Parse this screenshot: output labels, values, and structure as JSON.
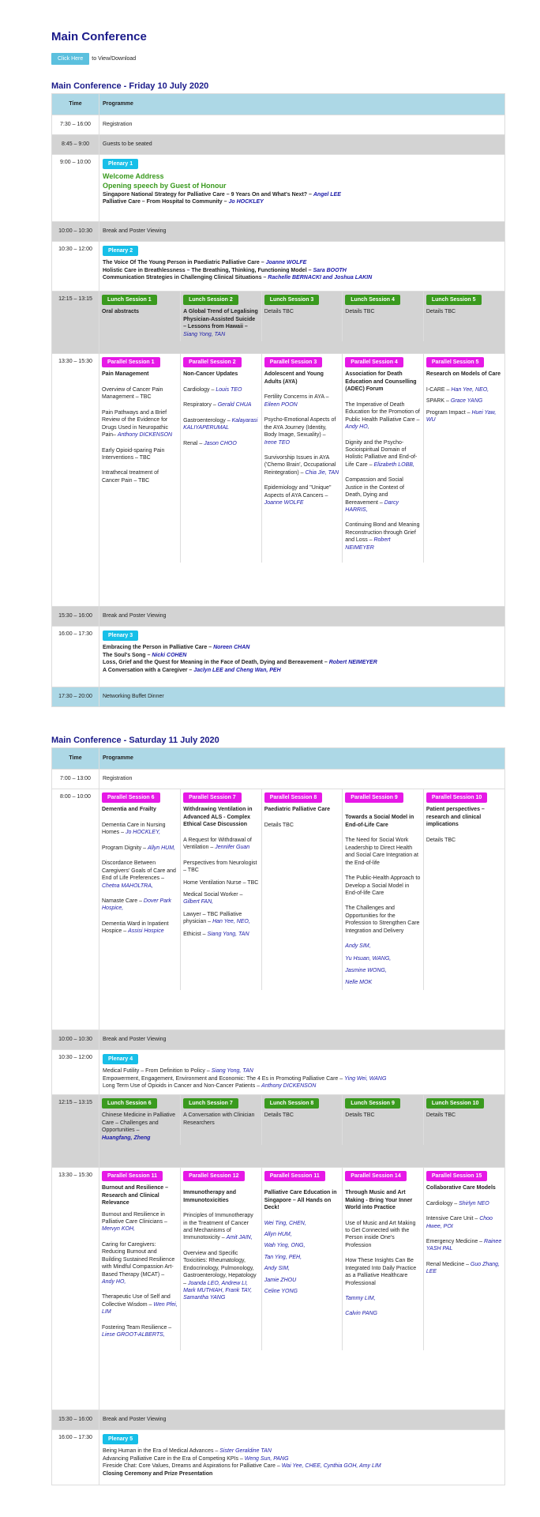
{
  "page_title": "Main Conference",
  "download": {
    "button": "Click Here",
    "text": "to View/Download"
  },
  "day1": {
    "heading": "Main Conference - Friday 10 July 2020"
  },
  "day2": {
    "heading": "Main Conference - Saturday 11 July 2020"
  },
  "table_headers": {
    "time": "Time",
    "programme": "Programme"
  },
  "d1": {
    "r1": {
      "time": "7:30 – 16:00",
      "text": "Registration"
    },
    "r2": {
      "time": "8:45 – 9:00",
      "text": "Guests to be seated"
    },
    "r3": {
      "time": "9:00 – 10:00",
      "badge": "Plenary 1",
      "welcome": "Welcome Address",
      "opening": "Opening speech by Guest of Honour",
      "l1": "Singapore National Strategy for Palliative Care – 9 Years On and What's Next? –",
      "l1s": "Angel LEE",
      "l2": "Palliative Care – From Hospital to Community –",
      "l2s": "Jo HOCKLEY"
    },
    "r4": {
      "time": "10:00 – 10:30",
      "text": "Break and Poster Viewing"
    },
    "r5": {
      "time": "10:30 – 12:00",
      "badge": "Plenary 2",
      "l1": "The Voice Of The Young Person in Paediatric Palliative Care –",
      "l1s": "Joanne WOLFE",
      "l2": "Holistic Care in Breathlessness – The Breathing, Thinking, Functioning Model –",
      "l2s": "Sara BOOTH",
      "l3": "Communication Strategies in Challenging Clinical Situations –",
      "l3s": "Rachelle BERNACKI and Joshua LAKIN"
    },
    "r6": {
      "time": "12:15 – 13:15",
      "c1b": "Lunch Session 1",
      "c1": "Oral abstracts",
      "c2b": "Lunch Session 2",
      "c2": "A Global Trend of Legalising Physician-Assisted Suicide – Lessons from Hawaii –",
      "c2s": "Siang Yong, TAN",
      "c3b": "Lunch Session 3",
      "c3": "Details TBC",
      "c4b": "Lunch Session 4",
      "c4": "Details TBC",
      "c5b": "Lunch Session 5",
      "c5": "Details TBC"
    },
    "r7": {
      "time": "13:30 – 15:30",
      "p1b": "Parallel Session 1",
      "p1t": "Pain Management",
      "p1a": "Overview of Cancer Pain Management – TBC",
      "p1c": "Pain Pathways and a Brief Review of the Evidence for Drugs Used in Neuropathic Pain–",
      "p1cs": "Anthony DICKENSON",
      "p1d": "Early Opioid-sparing Pain Interventions – TBC",
      "p1e": "Intrathecal treatment of Cancer Pain – TBC",
      "p2b": "Parallel Session 2",
      "p2t": "Non-Cancer Updates",
      "p2a": "Cardiology –",
      "p2as": "Louis TEO",
      "p2c": "Respiratory –",
      "p2cs": "Gerald CHUA",
      "p2d": "Gastroenterology –",
      "p2ds": "Kalayarasi KALIYAPERUMAL",
      "p2e": "Renal –",
      "p2es": "Jason CHOO",
      "p3b": "Parallel Session 3",
      "p3t": "Adolescent and Young Adults (AYA)",
      "p3a": "Fertility Concerns in AYA –",
      "p3as": "Eileen POON",
      "p3c": "Psycho-Emotional Aspects of the AYA Journey (Identity, Body Image, Sexuality) –",
      "p3cs": "Irene TEO",
      "p3d": "Survivorship Issues in AYA ('Chemo Brain', Occupational Reintegration) –",
      "p3ds": "Chia Jie, TAN",
      "p3e": "Epidemiology and \"Unique\" Aspects of AYA Cancers –",
      "p3es": "Joanne WOLFE",
      "p4b": "Parallel Session 4",
      "p4t": "Association for Death Education and Counselling (ADEC) Forum",
      "p4a": "The Imperative of Death Education for the Promotion of Public Health Palliative Care –",
      "p4as": "Andy HO,",
      "p4c": "Dignity and the Psycho-Socioispiritual Domain of Holistic Palliative and End-of-Life Care –",
      "p4cs": "Elizabeth LOBB,",
      "p4d": "Compassion and Social Justice in the Context of Death, Dying and Bereavement –",
      "p4ds": "Darcy HARRIS,",
      "p4e": "Continuing Bond and Meaning Reconstruction through Grief and Loss –",
      "p4es": "Robert NEIMEYER",
      "p5b": "Parallel Session 5",
      "p5t": "Research on Models of Care",
      "p5a": "I-CARE –",
      "p5as": "Han Yee, NEO,",
      "p5c": "SPARK –",
      "p5cs": "Grace YANG",
      "p5d": "Program Impact –",
      "p5ds": "Huei Yaw, WU"
    },
    "r8": {
      "time": "15:30 – 16:00",
      "text": "Break and Poster Viewing"
    },
    "r9": {
      "time": "16:00 – 17:30",
      "badge": "Plenary 3",
      "l1": "Embracing the Person in Palliative Care –",
      "l1s": "Noreen CHAN",
      "l2": "The Soul's Song –",
      "l2s": "Nicki COHEN",
      "l3": "Loss, Grief and the Quest for Meaning in the Face of Death, Dying and Bereavement –",
      "l3s": "Robert NEIMEYER",
      "l4": "A Conversation with a Caregiver –",
      "l4s": "Jaclyn LEE and Cheng Wan, PEH"
    },
    "r10": {
      "time": "17:30 – 20:00",
      "text": "Networking Buffet Dinner"
    }
  },
  "d2": {
    "r1": {
      "time": "7:00 – 13:00",
      "text": "Registration"
    },
    "r2": {
      "time": "8:00 – 10:00",
      "p6b": "Parallel Session 6",
      "p6t": "Dementia and Frailty",
      "p6a": "Dementia Care in Nursing Homes –",
      "p6as": "Jo HOCKLEY,",
      "p6c": "Program Dignity –",
      "p6cs": "Allyn HUM,",
      "p6d": "Discordance Between Caregivers' Goals of Care and End of Life Preferences –",
      "p6ds": "Chetna MAHOLTRA,",
      "p6e": "Namaste Care –",
      "p6es": "Dover Park Hospice,",
      "p6f": "Dementia Ward in Inpatient Hospice –",
      "p6fs": "Assisi Hospice",
      "p7b": "Parallel Session 7",
      "p7t": "Withdrawing Ventilation in Advanced ALS - Complex Ethical Case Discussion",
      "p7a": "A Request for Withdrawal of Ventilation –",
      "p7as": "Jennifer Guan",
      "p7c": "Perspectives from Neurologist – TBC",
      "p7d": "Home Ventilation Nurse – TBC",
      "p7e": "Medical Social Worker –",
      "p7es": "Gilbert FAN,",
      "p7f": "Lawyer – TBC Palliative physician –",
      "p7fs": "Han Yee, NEO,",
      "p7g": "Ethicist –",
      "p7gs": "Siang Yong, TAN",
      "p8b": "Parallel Session 8",
      "p8t": "Paediatric Palliative Care",
      "p8a": "Details TBC",
      "p9b": "Parallel Session 9",
      "p9t": "Towards a Social Model in End-of-Life Care",
      "p9a": "The Need for Social Work Leadership to Direct Health and Social Care Integration at the End-of-life",
      "p9c": "The Public-Health Approach to Develop a Social Model in End-of-life Care",
      "p9d": "The Challenges and Opportunities for the Profession to Strengthen Care Integration and Delivery",
      "p9s1": "Andy SIM,",
      "p9s2": "Yu Hsuan, WANG,",
      "p9s3": "Jasmine WONG,",
      "p9s4": "Nelle MOK",
      "p10b": "Parallel Session 10",
      "p10t": "Patient perspectives – research and clinical implications",
      "p10a": "Details TBC"
    },
    "r3": {
      "time": "10:00 – 10:30",
      "text": "Break and Poster Viewing"
    },
    "r4": {
      "time": "10:30 – 12:00",
      "badge": "Plenary 4",
      "l1": "Medical Futility – From Definition to Policy –",
      "l1s": "Siang Yong, TAN",
      "l2": "Empowerment, Engagement, Environment and Economic: The 4 Es in Promoting Palliative Care –",
      "l2s": "Ying Wei, WANG",
      "l3": "Long Term Use of Opioids in Cancer and Non-Cancer Patients –",
      "l3s": "Anthony DICKENSON"
    },
    "r5": {
      "time": "12:15 – 13:15",
      "c1b": "Lunch Session 6",
      "c1": "Chinese Medicine in Palliative Care – Challenges and Opportunities –",
      "c1s": "Huangfang, Zheng",
      "c2b": "Lunch Session 7",
      "c2": "A Conversation with Clinician Researchers",
      "c3b": "Lunch Session 8",
      "c3": "Details TBC",
      "c4b": "Lunch Session 9",
      "c4": "Details TBC",
      "c5b": "Lunch Session 10",
      "c5": "Details TBC"
    },
    "r6": {
      "time": "13:30 – 15:30",
      "q1b": "Parallel Session 11",
      "q1t": "Burnout and Resilience – Research and Clinical Relevance",
      "q1a": "Burnout and Resilience in Palliative Care Clinicians –",
      "q1as": "Mervyn KOH,",
      "q1c": "Caring for Caregivers: Reducing Burnout and Building Sustained Resilience with Mindful Compassion Art-Based Therapy (MCAT) –",
      "q1cs": "Andy HO,",
      "q1d": "Therapeutic Use of Self and Collective Wisdom –",
      "q1ds": "Wen Pfei, LIM",
      "q1e": "Fostering Team Resilience –",
      "q1es": "Liese GROOT-ALBERTS,",
      "q2b": "Parallel Session 12",
      "q2t": "Immunotherapy and Immunotoxicities",
      "q2a": "Principles of Immunotherapy in the Treatment of Cancer and Mechanisms of Immunotoxicity –",
      "q2as": "Amit JAIN,",
      "q2c": "Overview and Specific Toxicities: Rheumatology, Endocrinology, Pulmonology, Gastroenterology, Hepatology –",
      "q2cs": "Joanda LEO, Andrew LI, Mark MUTHIAH, Frank TAY, Samantha YANG",
      "q3b": "Parallel Session 11",
      "q3t": "Palliative Care Education in Singapore – All Hands on Deck!",
      "q3s1": "Wei Ting, CHEN,",
      "q3s2": "Allyn HUM,",
      "q3s3": "Wah Ying, ONG,",
      "q3s4": "Tan Ying, PEH,",
      "q3s5": "Andy SIM,",
      "q3s6": "Jamie ZHOU",
      "q3s7": "Celine YONG",
      "q4b": "Parallel Session 14",
      "q4t": "Through Music and Art Making - Bring Your Inner World into Practice",
      "q4a": "Use of Music and Art Making to Get Connected with the Person inside One's Profession",
      "q4c": "How These Insights Can Be Integrated Into Daily Practice as a Palliative Healthcare Professional",
      "q4s1": "Tammy LIM,",
      "q4s2": "Calvin PANG",
      "q5b": "Parallel Session 15",
      "q5t": "Collaborative Care Models",
      "q5a": "Cardiology –",
      "q5as": "Shirlyn NEO",
      "q5c": "Intensive Care Unit –",
      "q5cs": "Choo Hwee, POI",
      "q5d": "Emergency Medicine –",
      "q5ds": "Rainee YASH PAL",
      "q5e": "Renal Medicine –",
      "q5es": "Guo Zhang, LEE"
    },
    "r7": {
      "time": "15:30 – 16:00",
      "text": "Break and Poster Viewing"
    },
    "r8": {
      "time": "16:00 – 17:30",
      "badge": "Plenary 5",
      "l1": "Being Human in the Era of Medical Advances –",
      "l1s": "Sister Geraldine TAN",
      "l2": "Advancing Palliative Care in the Era of Competing KPIs –",
      "l2s": "Weng Sun, PANG",
      "l3": "Fireside Chat: Core Values, Dreams and Aspirations for Palliative Care –",
      "l3s": "Wai Yee, CHEE, Cynthia GOH, Amy LIM",
      "l4": "Closing Ceremony and Prize Presentation"
    }
  },
  "colors": {
    "heading": "#1a1a8a",
    "plenary": "#17bfe8",
    "lunch": "#3a9a1e",
    "parallel": "#e619e6",
    "header": "#add8e6",
    "grey": "#d3d3d3"
  }
}
